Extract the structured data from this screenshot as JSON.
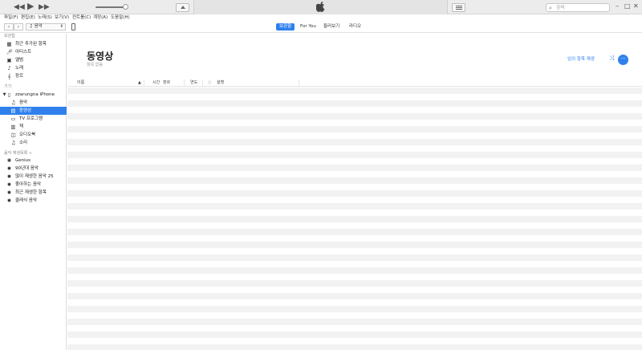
{
  "search": {
    "placeholder": "검색"
  },
  "menu": [
    "파일(F)",
    "편집(E)",
    "노래(S)",
    "보기(V)",
    "컨트롤(C)",
    "계정(A)",
    "도움말(H)"
  ],
  "media_selector": {
    "value": "음악"
  },
  "tabs": [
    {
      "label": "보관함",
      "active": true
    },
    {
      "label": "For You",
      "active": false
    },
    {
      "label": "둘러보기",
      "active": false
    },
    {
      "label": "라디오",
      "active": false
    }
  ],
  "sidebar": {
    "library_header": "보관함",
    "library": [
      {
        "label": "최근 추가된 항목",
        "icon": "calendar-icon"
      },
      {
        "label": "아티스트",
        "icon": "microphone-icon"
      },
      {
        "label": "앨범",
        "icon": "album-icon"
      },
      {
        "label": "노래",
        "icon": "music-note-icon"
      },
      {
        "label": "장르",
        "icon": "genre-icon"
      }
    ],
    "devices_header": "기기",
    "device_name": "zzarungna iPhone",
    "device_items": [
      {
        "label": "음악",
        "icon": "music-note-icon"
      },
      {
        "label": "동영상",
        "icon": "film-icon",
        "selected": true
      },
      {
        "label": "TV 프로그램",
        "icon": "tv-icon"
      },
      {
        "label": "책",
        "icon": "book-icon"
      },
      {
        "label": "오디오북",
        "icon": "audiobook-icon"
      },
      {
        "label": "소리",
        "icon": "bell-icon"
      }
    ],
    "playlists_header": "음악 재생목록 ÷",
    "playlists": [
      {
        "label": "Genius",
        "icon": "genius-icon"
      },
      {
        "label": "90년대 음악",
        "icon": "smart-playlist-icon"
      },
      {
        "label": "많이 재생한 음악 25",
        "icon": "smart-playlist-icon"
      },
      {
        "label": "좋아하는 음악",
        "icon": "smart-playlist-icon"
      },
      {
        "label": "최근 재생한 항목",
        "icon": "smart-playlist-icon"
      },
      {
        "label": "클래식 음악",
        "icon": "smart-playlist-icon"
      }
    ]
  },
  "main": {
    "title": "동영상",
    "subtitle": "항목 없음",
    "shuffle_label": "임의 항목 재생",
    "columns": [
      "이름",
      "시간",
      "장르",
      "연도",
      "설명"
    ]
  },
  "colors": {
    "accent": "#2f80ed",
    "stripe": "#f2f2f2"
  }
}
